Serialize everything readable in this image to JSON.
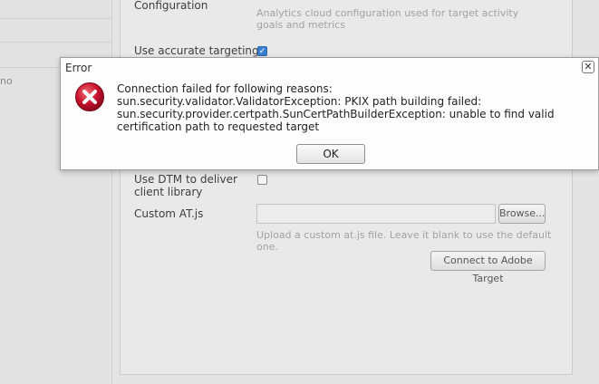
{
  "left": {
    "fragment_text": "no"
  },
  "panel": {
    "configuration_label": "Configuration",
    "configuration_hint": "Analytics cloud configuration used for target activity goals and metrics",
    "accurate_targeting_label": "Use accurate targeting",
    "accurate_targeting_checked": true,
    "dtm_label": "Use DTM to deliver client library",
    "dtm_checked": false,
    "custom_atjs_label": "Custom AT.js",
    "custom_atjs_value": "",
    "browse_label": "Browse...",
    "custom_atjs_hint": "Upload a custom at.js file. Leave it blank to use the default one.",
    "connect_label": "Connect to Adobe Target"
  },
  "dialog": {
    "title": "Error",
    "close_glyph": "✕",
    "message_line1": "Connection failed for following reasons:",
    "message_line2": "sun.security.validator.ValidatorException: PKIX path building failed: sun.security.provider.certpath.SunCertPathBuilderException: unable to find valid certification path to requested target",
    "ok_label": "OK",
    "icon": "error-icon",
    "icon_color": "#c8102e"
  }
}
